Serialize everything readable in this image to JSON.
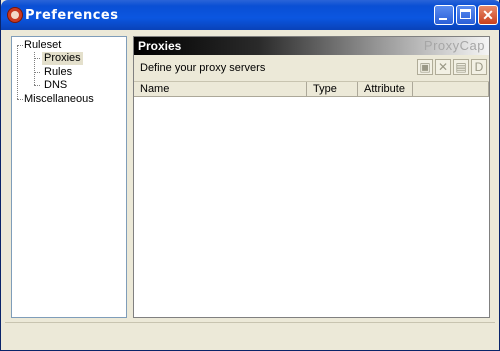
{
  "window": {
    "title": "Preferences",
    "icon": "proxycap-icon"
  },
  "title_buttons": {
    "minimize": "minimize-icon",
    "maximize": "maximize-icon",
    "close": "close-icon"
  },
  "tree": {
    "items": [
      {
        "label": "Ruleset"
      },
      {
        "label": "Proxies",
        "selected": true
      },
      {
        "label": "Rules"
      },
      {
        "label": "DNS"
      },
      {
        "label": "Miscellaneous"
      }
    ]
  },
  "panel": {
    "title": "Proxies",
    "brand": "ProxyCap",
    "description": "Define your proxy servers"
  },
  "toolbar": {
    "buttons": [
      "new-proxy-icon",
      "delete-icon",
      "properties-icon",
      "d-icon"
    ],
    "d_label": "D"
  },
  "table": {
    "columns": [
      "Name",
      "Type",
      "Attribute",
      ""
    ],
    "rows": []
  },
  "colors": {
    "titlebar": "#0a4fd4",
    "window_bg": "#ece9d8",
    "header_band_start": "#000000",
    "header_band_end": "#f5f5f5"
  }
}
